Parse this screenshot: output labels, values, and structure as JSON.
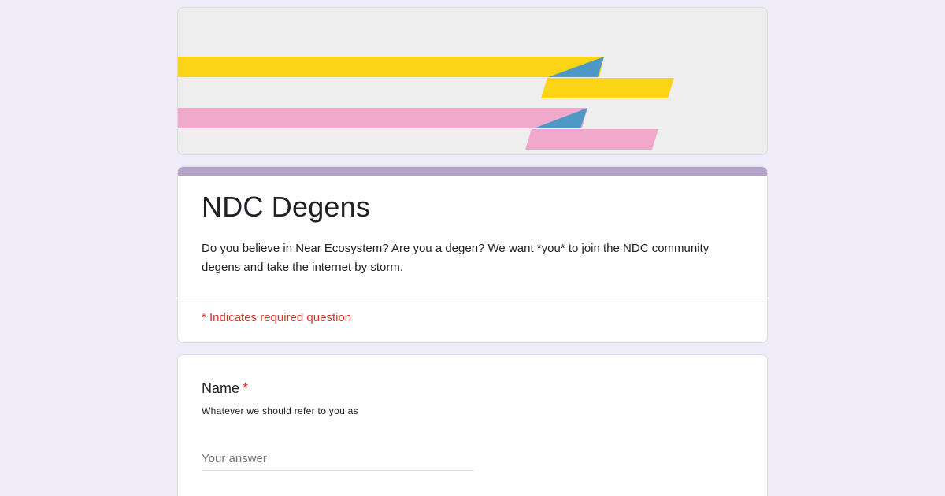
{
  "header": {
    "banner_colors": {
      "background": "#eeeeee",
      "yellow": "#fbd515",
      "pink": "#f0a9cb",
      "blue": "#4e98c8"
    }
  },
  "form": {
    "accent_color": "#b4a3c9",
    "title": "NDC Degens",
    "description": "Do you believe in Near Ecosystem? Are you a degen? We want *you* to join the NDC community degens and take the internet by storm.",
    "required_note": "* Indicates required question"
  },
  "questions": [
    {
      "title": "Name",
      "required_marker": "*",
      "description": "Whatever we should refer to you as",
      "placeholder": "Your answer",
      "value": ""
    }
  ]
}
